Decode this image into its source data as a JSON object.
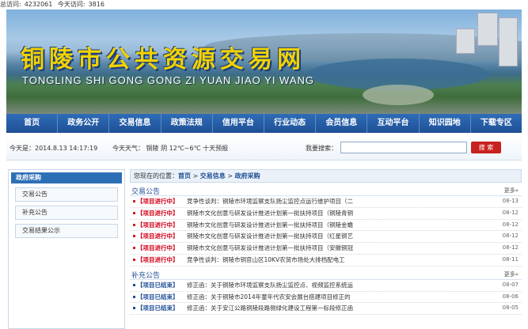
{
  "top_stats": {
    "total_label": "总访问:",
    "total_value": "4232061",
    "today_label": "今天访问:",
    "today_value": "3816"
  },
  "banner": {
    "title": "铜陵市公共资源交易网",
    "pinyin": "TONGLING SHI GONG GONG ZI YUAN JIAO YI WANG"
  },
  "nav": [
    "首页",
    "政务公开",
    "交易信息",
    "政策法规",
    "信用平台",
    "行业动态",
    "会员信息",
    "互动平台",
    "知识园地",
    "下载专区"
  ],
  "info": {
    "date": "今天是：2014.8.13 14:17:19",
    "weather": "今天天气：  铜陵 阴 12℃~6℃ 十天预报",
    "search_label": "我要搜索：",
    "search_value": "",
    "search_button": "搜 索"
  },
  "sidebar": {
    "head": "政府采购",
    "items": [
      "交易公告",
      "补充公告",
      "交易结果公示"
    ]
  },
  "crumb": {
    "prefix": "您现在的位置：",
    "home": "首页",
    "sep1": " > ",
    "level1": "交易信息",
    "sep2": " > ",
    "level2": "政府采购"
  },
  "section1": {
    "title": "交易公告",
    "more": "更多»"
  },
  "rows1": [
    {
      "status": "【项目进行中】",
      "text": "竞争性谈判：铜陵市环境监察支队扬尘监控点运行维护项目（二",
      "date": "08-13"
    },
    {
      "status": "【项目进行中】",
      "text": "铜陵市文化创意与研发设计推进计划第一批扶持项目（铜陵青铜",
      "date": "08-12"
    },
    {
      "status": "【项目进行中】",
      "text": "铜陵市文化创意与研发设计推进计划第一批扶持项目（铜陵金蟾",
      "date": "08-12"
    },
    {
      "status": "【项目进行中】",
      "text": "铜陵市文化创意与研发设计推进计划第一批扶持项目（红星铜艺",
      "date": "08-12"
    },
    {
      "status": "【项目进行中】",
      "text": "铜陵市文化创意与研发设计推进计划第一批扶持项目（安徽铜冠",
      "date": "08-12"
    },
    {
      "status": "【项目进行中】",
      "text": "竞争性谈判：铜陵市铜官山区10KV农贸市场处大排档配电工",
      "date": "08-11"
    }
  ],
  "section2": {
    "title": "补充公告",
    "more": "更多»"
  },
  "rows2": [
    {
      "status": "【项目已结束】",
      "text": "修正函：关于铜陵市环境监察支队扬尘监控点、视频监控系统运",
      "date": "08-07"
    },
    {
      "status": "【项目已结束】",
      "text": "修正函：关于铜陵市2014年童年代农安会展台搭建项目修正的",
      "date": "08-06"
    },
    {
      "status": "【项目已结束】",
      "text": "修正函：关于安江公路铜陵段路侧绿化建设工程第一标段修正函",
      "date": "08-05"
    }
  ]
}
